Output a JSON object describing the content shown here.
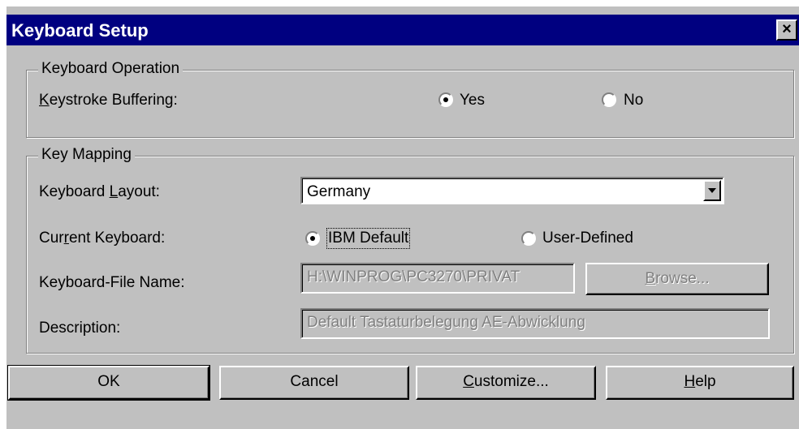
{
  "window": {
    "title": "Keyboard Setup",
    "close_label": "×"
  },
  "keyboard_operation": {
    "legend": "Keyboard Operation",
    "keystroke_buffering_label": "Keystroke Buffering:",
    "options": [
      "Yes",
      "No"
    ],
    "selected": "Yes"
  },
  "key_mapping": {
    "legend": "Key Mapping",
    "layout_label": "Keyboard Layout:",
    "layout_value": "Germany",
    "current_keyboard_label": "Current Keyboard:",
    "current_keyboard_options": [
      "IBM Default",
      "User-Defined"
    ],
    "current_keyboard_selected": "IBM Default",
    "file_name_label": "Keyboard-File Name:",
    "file_name_value": "H:\\WINPROG\\PC3270\\PRIVAT",
    "browse_label": "Browse...",
    "description_label": "Description:",
    "description_value": "Default Tastaturbelegung AE-Abwicklung"
  },
  "buttons": {
    "ok": "OK",
    "cancel": "Cancel",
    "customize": "Customize...",
    "help": "Help"
  },
  "colors": {
    "titlebar": "#000080",
    "face": "#c0c0c0"
  }
}
